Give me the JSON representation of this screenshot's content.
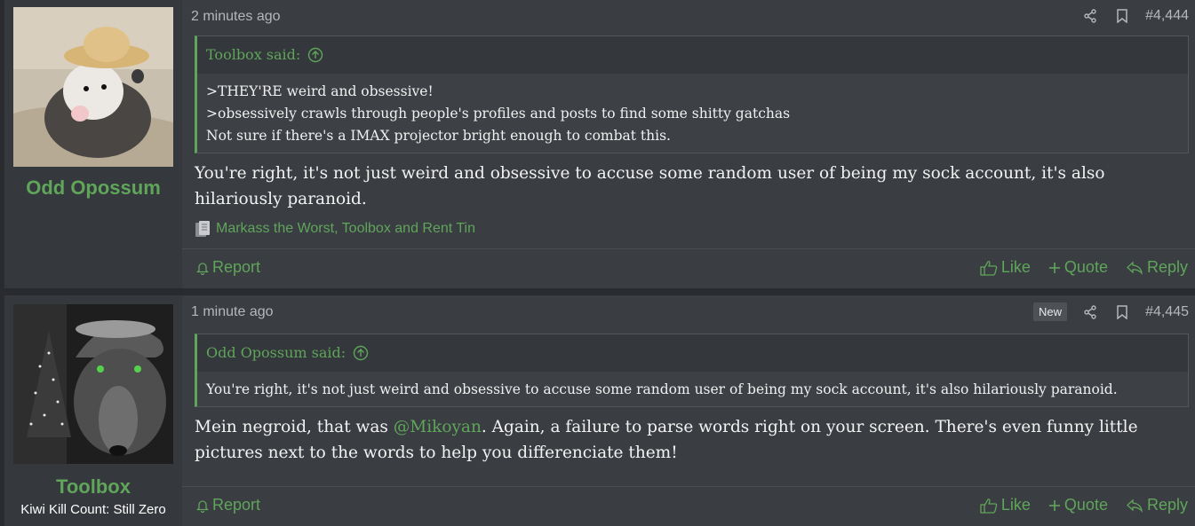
{
  "posts": [
    {
      "username": "Odd Opossum",
      "usertitle": "",
      "time": "2 minutes ago",
      "badge": "",
      "post_number": "#4,444",
      "quote": {
        "author_said": "Toolbox said:",
        "lines": [
          ">THEY'RE weird and obsessive!",
          ">obsessively crawls through people's profiles and posts to find some shitty gatchas",
          "Not sure if there's a IMAX projector bright enough to combat this."
        ]
      },
      "message": "You're right, it's not just weird and obsessive to accuse some random user of being my sock account, it's also hilariously paranoid.",
      "reactions": "Markass the Worst, Toolbox and Rent Tin",
      "actions": {
        "report": "Report",
        "like": "Like",
        "quote": "Quote",
        "reply": "Reply"
      }
    },
    {
      "username": "Toolbox",
      "usertitle": "Kiwi Kill Count: Still Zero",
      "time": "1 minute ago",
      "badge": "New",
      "post_number": "#4,445",
      "quote": {
        "author_said": "Odd Opossum said:",
        "lines": [
          "You're right, it's not just weird and obsessive to accuse some random user of being my sock account, it's also hilariously paranoid."
        ]
      },
      "message_pre": "Mein negroid, that was ",
      "mention": "@Mikoyan",
      "message_post": ". Again, a failure to parse words right on your screen. There's even funny little pictures next to the words to help you differenciate them!",
      "actions": {
        "report": "Report",
        "like": "Like",
        "quote": "Quote",
        "reply": "Reply"
      }
    }
  ],
  "colors": {
    "accent": "#5fa55a",
    "background": "#292b2e",
    "post_bg": "#3a3d42",
    "user_col_bg": "#35383c",
    "quote_bg": "#3d4045"
  },
  "icons": [
    "share-icon",
    "bookmark-icon",
    "arrow-up-circle-icon",
    "bell-icon",
    "thumbs-up-icon",
    "plus-icon",
    "reply-icon",
    "reaction-icon"
  ]
}
